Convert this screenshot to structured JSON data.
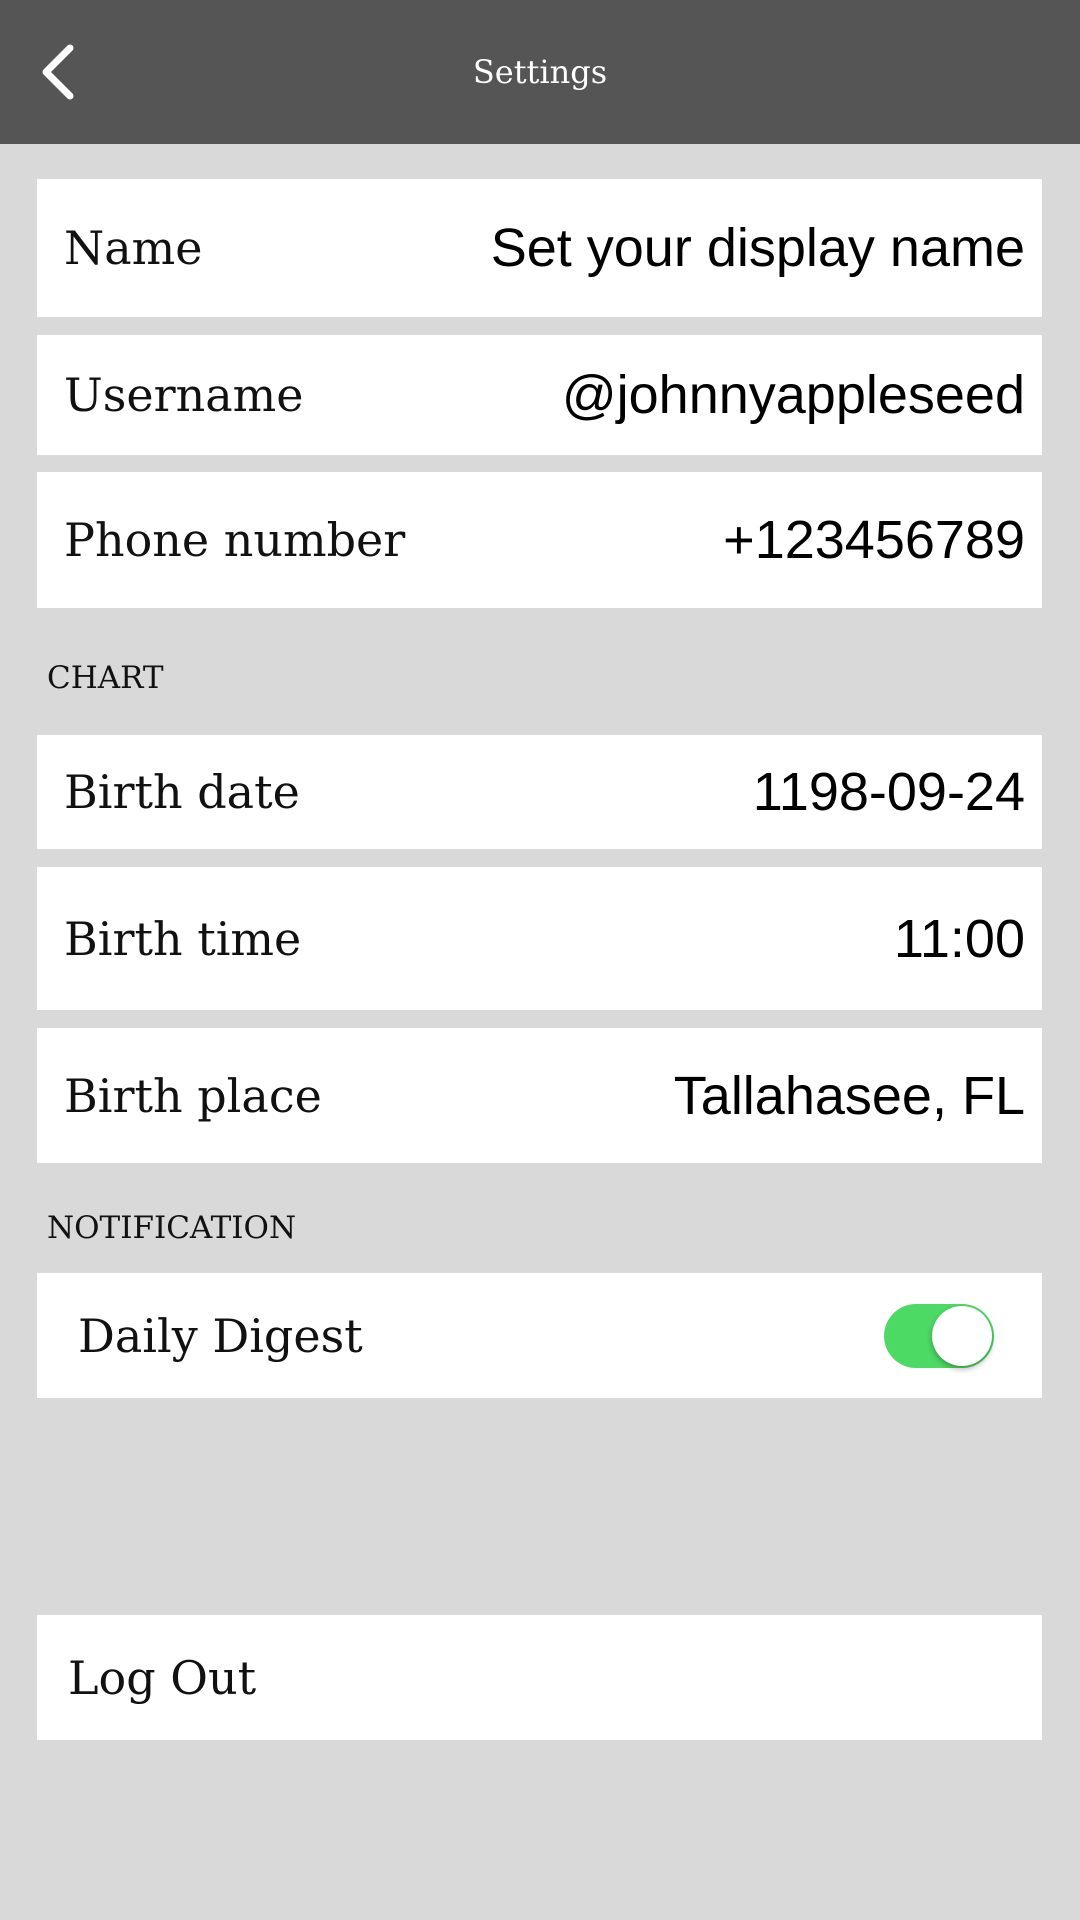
{
  "header": {
    "title": "Settings",
    "back_icon": "chevron-left-icon"
  },
  "profile": {
    "name": {
      "label": "Name",
      "value": "Set your display name"
    },
    "username": {
      "label": "Username",
      "value": "@johnnyappleseed"
    },
    "phone": {
      "label": "Phone number",
      "value": "+123456789"
    }
  },
  "chart": {
    "section_title": "CHART",
    "birth_date": {
      "label": "Birth date",
      "value": "1198-09-24"
    },
    "birth_time": {
      "label": "Birth time",
      "value": "11:00"
    },
    "birth_place": {
      "label": "Birth place",
      "value": "Tallahasee, FL"
    }
  },
  "notification": {
    "section_title": "NOTIFICATION",
    "daily_digest": {
      "label": "Daily Digest",
      "enabled": true
    }
  },
  "logout": {
    "label": "Log Out"
  },
  "colors": {
    "header_bg": "#555555",
    "page_bg": "#d9d9d9",
    "toggle_on": "#4cd964"
  }
}
